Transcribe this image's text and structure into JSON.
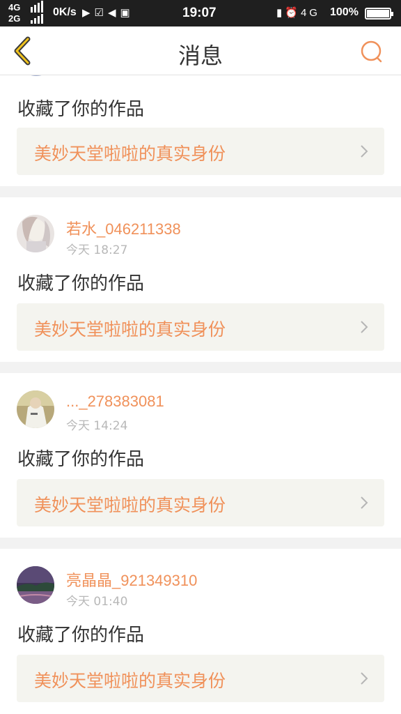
{
  "status_bar": {
    "net_top": "4G",
    "net_bottom": "2G",
    "speed": "0K/s",
    "time": "19:07",
    "network": "4G",
    "battery": "100%"
  },
  "nav": {
    "title": "消息"
  },
  "messages": [
    {
      "name": "",
      "time": "",
      "action": "收藏了你的作品",
      "work": "美妙天堂啦啦的真实身份"
    },
    {
      "name": "若水_046211338",
      "time": "今天 18:27",
      "action": "收藏了你的作品",
      "work": "美妙天堂啦啦的真实身份"
    },
    {
      "name": "..._278383081",
      "time": "今天 14:24",
      "action": "收藏了你的作品",
      "work": "美妙天堂啦啦的真实身份"
    },
    {
      "name": "亮晶晶_921349310",
      "time": "今天 01:40",
      "action": "收藏了你的作品",
      "work": "美妙天堂啦啦的真实身份"
    }
  ],
  "colors": {
    "accent": "#f0915a",
    "status_bar": "#1f1f1f",
    "link_bg": "#f4f4ef",
    "separator": "#f2f2f2"
  }
}
